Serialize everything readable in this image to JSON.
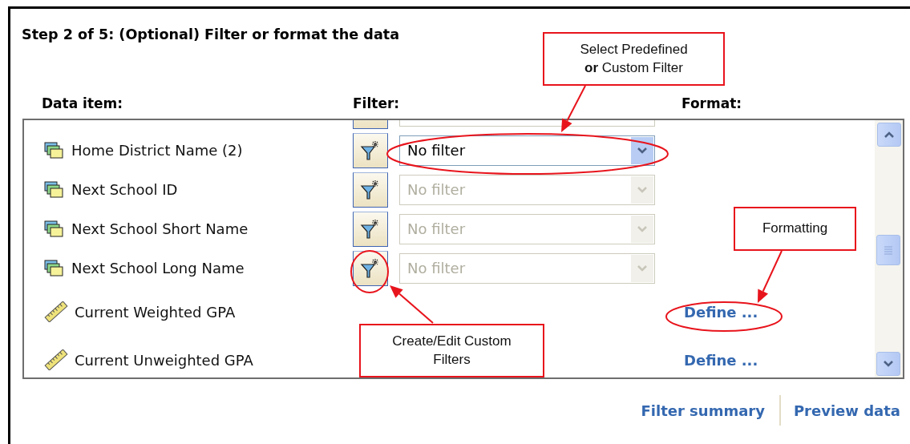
{
  "title": "Step 2 of 5: (Optional) Filter or format the data",
  "columns": [
    "Data item:",
    "Filter:",
    "Format:"
  ],
  "rows": [
    {
      "kind": "attribute",
      "name": "Home District Name (2)",
      "filter": "No filter",
      "disabled": false
    },
    {
      "kind": "attribute",
      "name": "Next School ID",
      "filter": "No filter",
      "disabled": true
    },
    {
      "kind": "attribute",
      "name": "Next School Short Name",
      "filter": "No filter",
      "disabled": true
    },
    {
      "kind": "attribute",
      "name": "Next School Long Name",
      "filter": "No filter",
      "disabled": true
    },
    {
      "kind": "measure",
      "name": "Current Weighted GPA",
      "format": "Define ..."
    },
    {
      "kind": "measure",
      "name": "Current Unweighted GPA",
      "format": "Define ..."
    }
  ],
  "links": [
    "Filter summary",
    "Preview data"
  ],
  "callouts": [
    {
      "text": "Select Predefined\n**or** Custom Filter"
    },
    {
      "text": "Formatting"
    },
    {
      "text": "Create/Edit Custom Filters"
    }
  ]
}
